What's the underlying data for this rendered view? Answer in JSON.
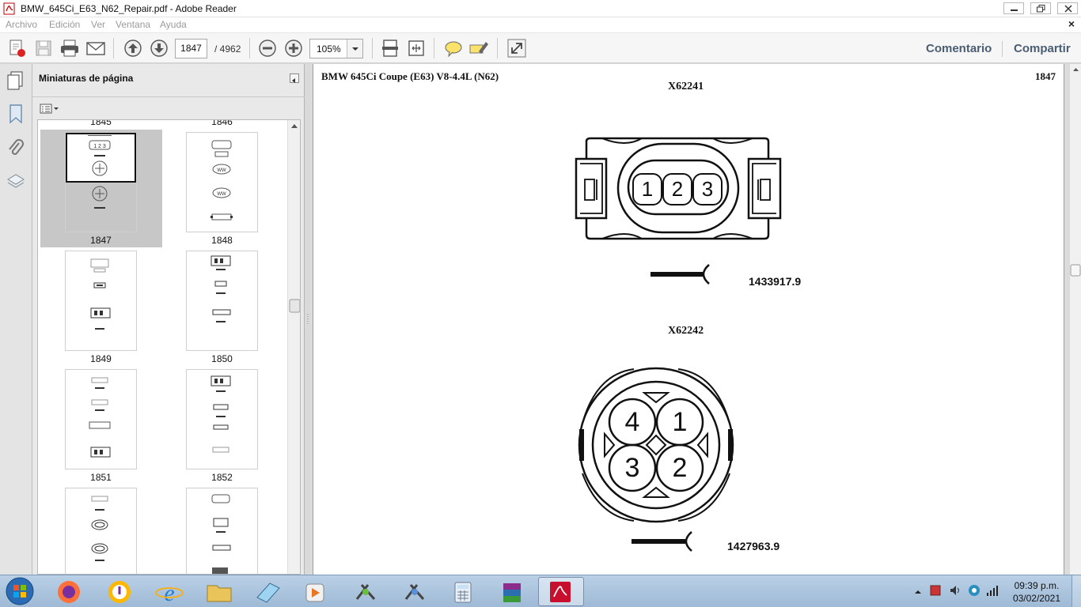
{
  "window": {
    "title": "BMW_645Ci_E63_N62_Repair.pdf - Adobe Reader"
  },
  "menu": {
    "items": [
      "Archivo",
      "Edición",
      "Ver",
      "Ventana",
      "Ayuda"
    ],
    "close_doc": "×"
  },
  "toolbar": {
    "page_current": "1847",
    "page_total": "/ 4962",
    "zoom": "105%",
    "comment_label": "Comentario",
    "share_label": "Compartir"
  },
  "panel": {
    "title": "Miniaturas de página",
    "labels": [
      "1845",
      "1846",
      "1847",
      "1848",
      "1849",
      "1850",
      "1851",
      "1852"
    ],
    "selected_page": "1847"
  },
  "document": {
    "header_title": "BMW 645Ci Coupe (E63) V8-4.4L (N62)",
    "header_page": "1847",
    "connectors": [
      {
        "id": "X62241",
        "part_number": "1433917.9",
        "pins": [
          "1",
          "2",
          "3"
        ]
      },
      {
        "id": "X62242",
        "part_number": "1427963.9",
        "pins": [
          "4",
          "1",
          "3",
          "2"
        ]
      }
    ]
  },
  "taskbar": {
    "time": "09:39 p.m.",
    "date": "03/02/2021"
  },
  "colors": {
    "accent_link": "#4b5d73",
    "taskbar": "#a9c3dc",
    "pdf_red": "#c8102e"
  }
}
